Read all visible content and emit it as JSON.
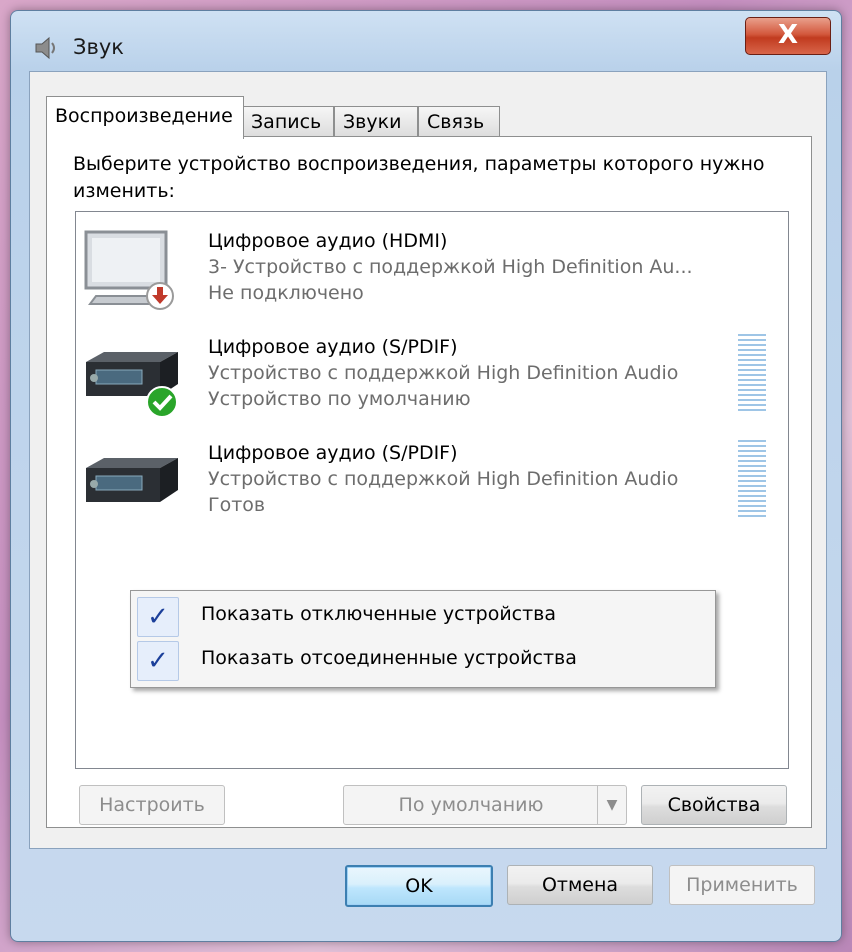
{
  "window": {
    "title": "Звук",
    "close_label": "X"
  },
  "tabs": [
    {
      "label": "Воспроизведение",
      "active": true
    },
    {
      "label": "Запись",
      "active": false
    },
    {
      "label": "Звуки",
      "active": false
    },
    {
      "label": "Связь",
      "active": false
    }
  ],
  "instructions": "Выберите устройство воспроизведения, параметры которого нужно изменить:",
  "devices": [
    {
      "name": "Цифровое аудио (HDMI)",
      "description": "3- Устройство с поддержкой High Definition Au...",
      "status": "Не подключено",
      "icon": "monitor-icon",
      "badge": "disconnected-badge-icon"
    },
    {
      "name": "Цифровое аудио (S/PDIF)",
      "description": "Устройство с поддержкой High Definition Audio",
      "status": "Устройство по умолчанию",
      "icon": "receiver-icon",
      "badge": "default-checkmark-icon"
    },
    {
      "name": "Цифровое аудио (S/PDIF)",
      "description": "Устройство с поддержкой High Definition Audio",
      "status": "Готов",
      "icon": "receiver-icon",
      "badge": ""
    }
  ],
  "context_menu": {
    "items": [
      {
        "label": "Показать отключенные устройства",
        "checked": true
      },
      {
        "label": "Показать отсоединенные устройства",
        "checked": true
      }
    ],
    "check_glyph": "✓"
  },
  "panel_buttons": {
    "configure": "Настроить",
    "set_default": "По умолчанию",
    "properties": "Свойства"
  },
  "dialog_buttons": {
    "ok": "OK",
    "cancel": "Отмена",
    "apply": "Применить"
  },
  "colors": {
    "accent": "#3c7fb1",
    "close_button": "#c13b1f",
    "check_color": "#1b3f9a",
    "default_badge": "#2aa52a",
    "disconnected_badge": "#c0392b"
  }
}
